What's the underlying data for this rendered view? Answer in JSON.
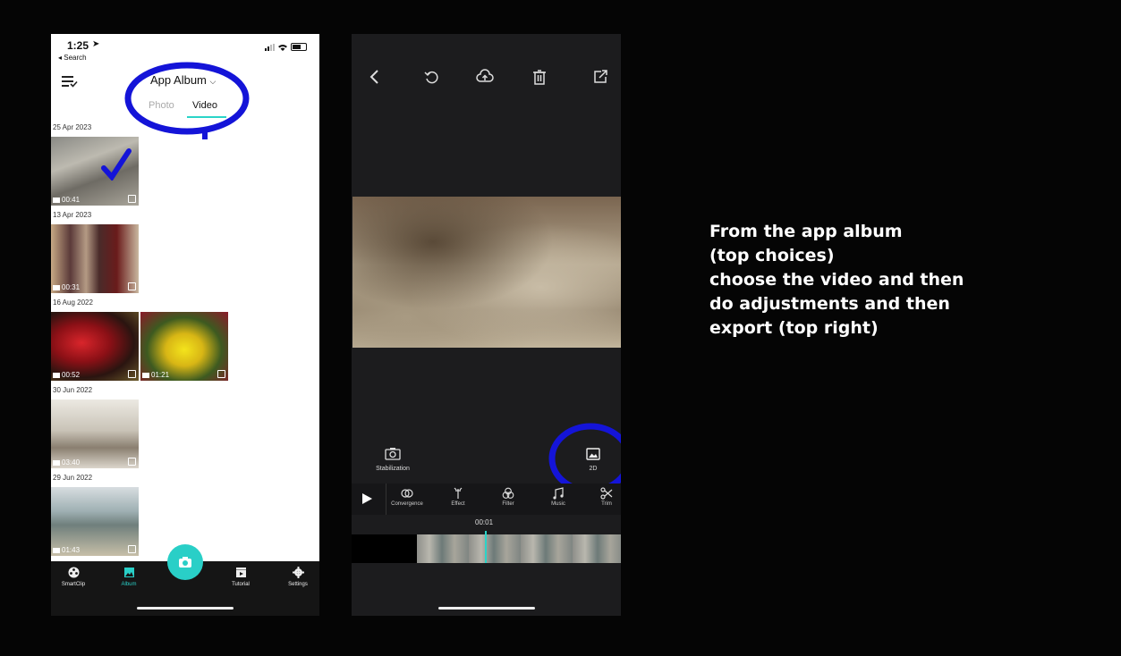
{
  "phone1": {
    "status_time": "1:25",
    "status_back": "◂ Search",
    "header_title": "App Album",
    "tabs": [
      "Photo",
      "Video"
    ],
    "groups": [
      {
        "date": "25 Apr 2023",
        "items": [
          {
            "duration": "00:41"
          }
        ]
      },
      {
        "date": "13 Apr 2023",
        "items": [
          {
            "duration": "00:31"
          }
        ]
      },
      {
        "date": "16 Aug 2022",
        "items": [
          {
            "duration": "00:52"
          },
          {
            "duration": "01:21"
          }
        ]
      },
      {
        "date": "30 Jun 2022",
        "items": [
          {
            "duration": "03:40"
          }
        ]
      },
      {
        "date": "29 Jun 2022",
        "items": [
          {
            "duration": "01:43"
          }
        ]
      }
    ],
    "tabbar": [
      "SmartClip",
      "Album",
      "Tutorial",
      "Settings"
    ]
  },
  "phone2": {
    "left_option": "Stabilization",
    "right_option": "2D",
    "tools": [
      "Convergence",
      "Effect",
      "Filter",
      "Music",
      "Trim"
    ],
    "timecode": "00:01"
  },
  "caption": [
    "From the app album",
    "(top choices)",
    "choose the video and then",
    "do adjustments and then",
    "export (top right)"
  ],
  "colors": {
    "accent": "#2ad4c8",
    "annotation": "#1414d8"
  }
}
